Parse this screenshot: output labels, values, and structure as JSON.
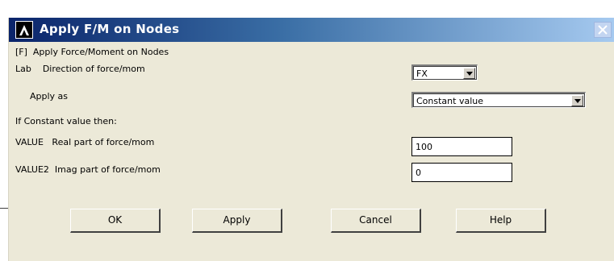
{
  "window": {
    "title": "Apply F/M on Nodes",
    "close_icon": "close-icon",
    "app_icon": "ansys-logo-icon"
  },
  "form": {
    "heading": "[F]  Apply Force/Moment on Nodes",
    "lab_label": "Lab    Direction of force/mom",
    "lab_value": "FX",
    "apply_as_label": "Apply as",
    "apply_as_value": "Constant value",
    "if_constant_label": "If Constant value then:",
    "value_label": "VALUE   Real part of force/mom",
    "value_value": "100",
    "value2_label": "VALUE2  Imag part of force/mom",
    "value2_value": "0"
  },
  "buttons": {
    "ok": "OK",
    "apply": "Apply",
    "cancel": "Cancel",
    "help": "Help"
  },
  "colors": {
    "titlebar_start": "#0a246a",
    "titlebar_end": "#a6caf0",
    "dialog_bg": "#ece9d8"
  }
}
